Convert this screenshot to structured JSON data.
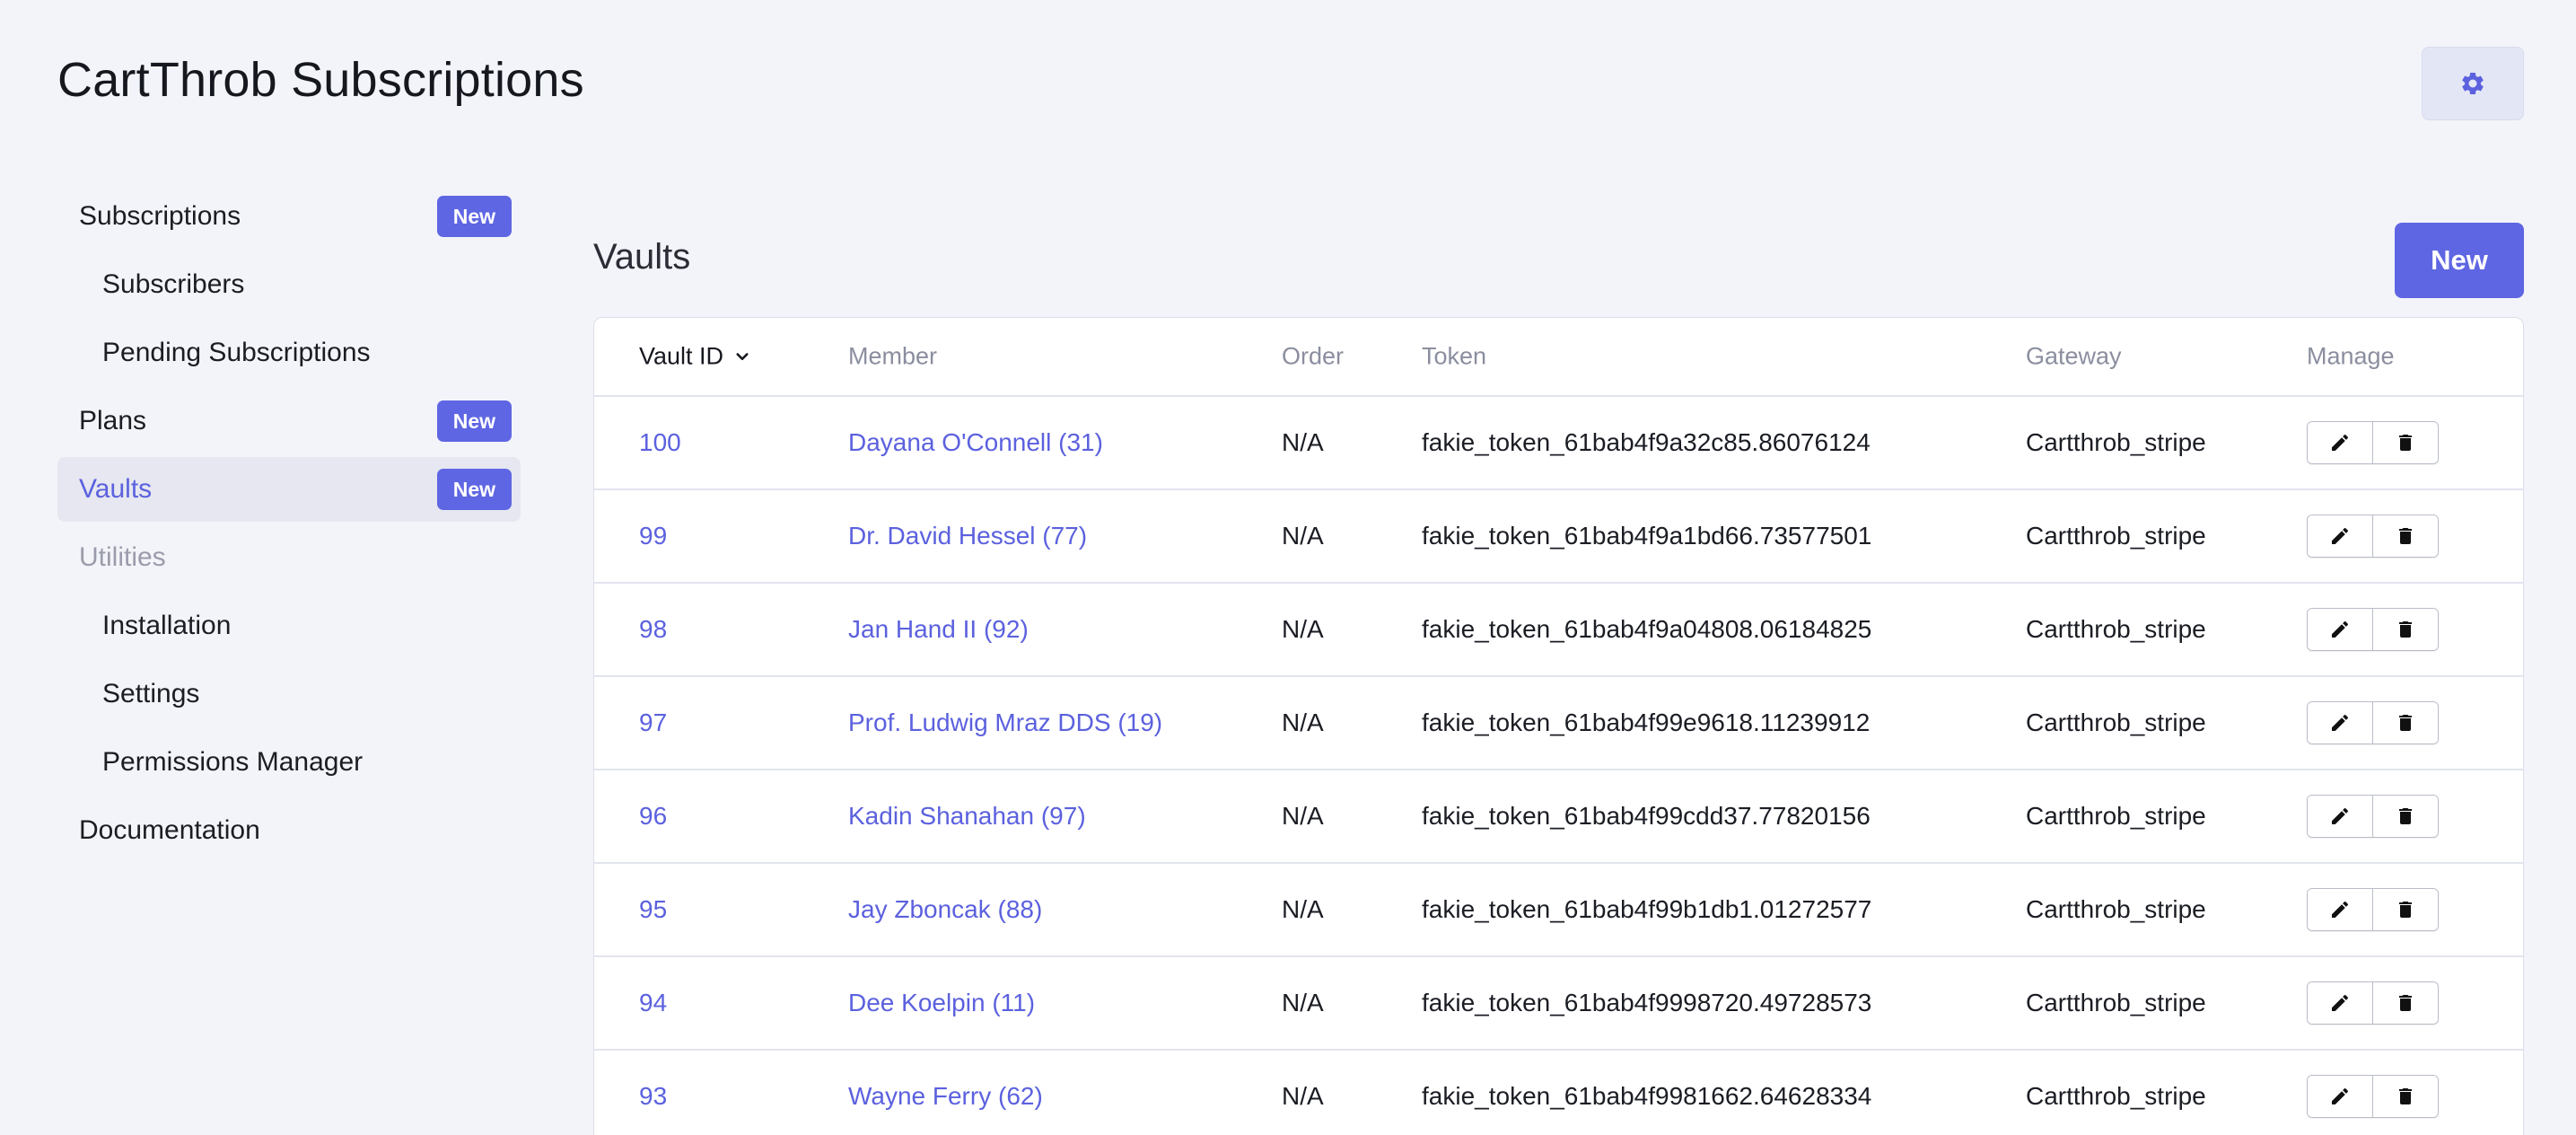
{
  "header": {
    "title": "CartThrob Subscriptions",
    "settings_icon": "gear-icon"
  },
  "sidebar": {
    "items": [
      {
        "label": "Subscriptions",
        "badge": "New"
      },
      {
        "label": "Subscribers"
      },
      {
        "label": "Pending Subscriptions"
      },
      {
        "label": "Plans",
        "badge": "New"
      },
      {
        "label": "Vaults",
        "badge": "New",
        "active": true
      },
      {
        "label": "Utilities"
      },
      {
        "label": "Installation"
      },
      {
        "label": "Settings"
      },
      {
        "label": "Permissions Manager"
      },
      {
        "label": "Documentation"
      }
    ]
  },
  "main": {
    "title": "Vaults",
    "new_button": "New",
    "columns": {
      "vault_id": "Vault ID",
      "member": "Member",
      "order": "Order",
      "token": "Token",
      "gateway": "Gateway",
      "manage": "Manage"
    },
    "rows": [
      {
        "id": "100",
        "member": "Dayana O'Connell (31)",
        "order": "N/A",
        "token": "fakie_token_61bab4f9a32c85.86076124",
        "gateway": "Cartthrob_stripe"
      },
      {
        "id": "99",
        "member": "Dr. David Hessel (77)",
        "order": "N/A",
        "token": "fakie_token_61bab4f9a1bd66.73577501",
        "gateway": "Cartthrob_stripe"
      },
      {
        "id": "98",
        "member": "Jan Hand II (92)",
        "order": "N/A",
        "token": "fakie_token_61bab4f9a04808.06184825",
        "gateway": "Cartthrob_stripe"
      },
      {
        "id": "97",
        "member": "Prof. Ludwig Mraz DDS (19)",
        "order": "N/A",
        "token": "fakie_token_61bab4f99e9618.11239912",
        "gateway": "Cartthrob_stripe"
      },
      {
        "id": "96",
        "member": "Kadin Shanahan (97)",
        "order": "N/A",
        "token": "fakie_token_61bab4f99cdd37.77820156",
        "gateway": "Cartthrob_stripe"
      },
      {
        "id": "95",
        "member": "Jay Zboncak (88)",
        "order": "N/A",
        "token": "fakie_token_61bab4f99b1db1.01272577",
        "gateway": "Cartthrob_stripe"
      },
      {
        "id": "94",
        "member": "Dee Koelpin (11)",
        "order": "N/A",
        "token": "fakie_token_61bab4f9998720.49728573",
        "gateway": "Cartthrob_stripe"
      },
      {
        "id": "93",
        "member": "Wayne Ferry (62)",
        "order": "N/A",
        "token": "fakie_token_61bab4f9981662.64628334",
        "gateway": "Cartthrob_stripe"
      }
    ]
  },
  "colors": {
    "accent": "#5f66e3",
    "background": "#f3f4f9"
  }
}
